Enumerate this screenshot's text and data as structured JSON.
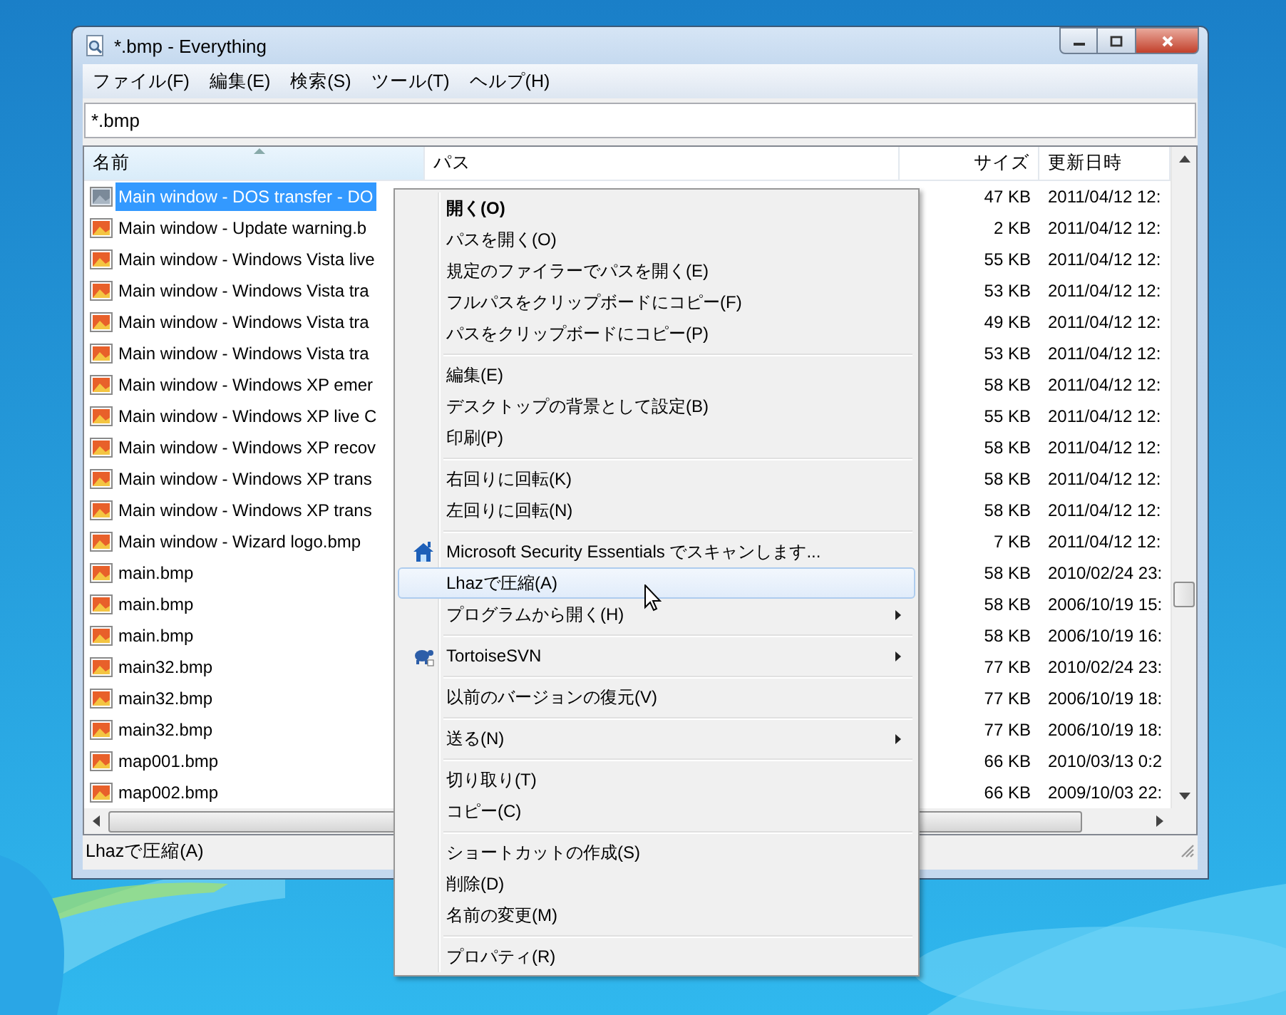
{
  "window": {
    "title": "*.bmp - Everything"
  },
  "menu_bar": [
    "ファイル(F)",
    "編集(E)",
    "検索(S)",
    "ツール(T)",
    "ヘルプ(H)"
  ],
  "search": {
    "value": "*.bmp"
  },
  "table": {
    "columns": [
      {
        "label": "名前",
        "sorted": true
      },
      {
        "label": "パス",
        "sorted": false
      },
      {
        "label": "サイズ",
        "sorted": false
      },
      {
        "label": "更新日時",
        "sorted": false
      }
    ],
    "rows": [
      {
        "name": "Main window - DOS transfer - DO",
        "size": "47 KB",
        "modified": "2011/04/12 12:",
        "selected": true
      },
      {
        "name": "Main window - Update warning.b",
        "size": "2 KB",
        "modified": "2011/04/12 12:",
        "selected": false
      },
      {
        "name": "Main window - Windows Vista live",
        "size": "55 KB",
        "modified": "2011/04/12 12:",
        "selected": false
      },
      {
        "name": "Main window - Windows Vista tra",
        "size": "53 KB",
        "modified": "2011/04/12 12:",
        "selected": false
      },
      {
        "name": "Main window - Windows Vista tra",
        "size": "49 KB",
        "modified": "2011/04/12 12:",
        "selected": false
      },
      {
        "name": "Main window - Windows Vista tra",
        "size": "53 KB",
        "modified": "2011/04/12 12:",
        "selected": false
      },
      {
        "name": "Main window - Windows XP emer",
        "size": "58 KB",
        "modified": "2011/04/12 12:",
        "selected": false
      },
      {
        "name": "Main window - Windows XP live C",
        "size": "55 KB",
        "modified": "2011/04/12 12:",
        "selected": false
      },
      {
        "name": "Main window - Windows XP recov",
        "size": "58 KB",
        "modified": "2011/04/12 12:",
        "selected": false
      },
      {
        "name": "Main window - Windows XP trans",
        "size": "58 KB",
        "modified": "2011/04/12 12:",
        "selected": false
      },
      {
        "name": "Main window - Windows XP trans",
        "size": "58 KB",
        "modified": "2011/04/12 12:",
        "selected": false
      },
      {
        "name": "Main window - Wizard logo.bmp",
        "size": "7 KB",
        "modified": "2011/04/12 12:",
        "selected": false
      },
      {
        "name": "main.bmp",
        "size": "58 KB",
        "modified": "2010/02/24 23:",
        "selected": false
      },
      {
        "name": "main.bmp",
        "size": "58 KB",
        "modified": "2006/10/19 15:",
        "selected": false
      },
      {
        "name": "main.bmp",
        "size": "58 KB",
        "modified": "2006/10/19 16:",
        "selected": false
      },
      {
        "name": "main32.bmp",
        "size": "77 KB",
        "modified": "2010/02/24 23:",
        "selected": false
      },
      {
        "name": "main32.bmp",
        "size": "77 KB",
        "modified": "2006/10/19 18:",
        "selected": false
      },
      {
        "name": "main32.bmp",
        "size": "77 KB",
        "modified": "2006/10/19 18:",
        "selected": false
      },
      {
        "name": "map001.bmp",
        "size": "66 KB",
        "modified": "2010/03/13 0:2",
        "selected": false
      },
      {
        "name": "map002.bmp",
        "size": "66 KB",
        "modified": "2009/10/03 22:",
        "selected": false
      }
    ]
  },
  "status_bar": "Lhazで圧縮(A)",
  "context_menu": [
    {
      "kind": "item",
      "label": "開く(O)",
      "default": true,
      "selected": false
    },
    {
      "kind": "item",
      "label": "パスを開く(O)",
      "selected": false
    },
    {
      "kind": "item",
      "label": "規定のファイラーでパスを開く(E)",
      "selected": false
    },
    {
      "kind": "item",
      "label": "フルパスをクリップボードにコピー(F)",
      "selected": false
    },
    {
      "kind": "item",
      "label": "パスをクリップボードにコピー(P)",
      "selected": false
    },
    {
      "kind": "separator"
    },
    {
      "kind": "item",
      "label": "編集(E)",
      "selected": false
    },
    {
      "kind": "item",
      "label": "デスクトップの背景として設定(B)",
      "selected": false
    },
    {
      "kind": "item",
      "label": "印刷(P)",
      "selected": false
    },
    {
      "kind": "separator"
    },
    {
      "kind": "item",
      "label": "右回りに回転(K)",
      "selected": false
    },
    {
      "kind": "item",
      "label": "左回りに回転(N)",
      "selected": false
    },
    {
      "kind": "separator"
    },
    {
      "kind": "icon_item",
      "label": "Microsoft Security Essentials でスキャンします...",
      "selected": false
    },
    {
      "kind": "item",
      "label": "Lhazで圧縮(A)",
      "selected": true
    },
    {
      "kind": "item",
      "label": "プログラムから開く(H)",
      "submenu": true,
      "selected": false
    },
    {
      "kind": "separator"
    },
    {
      "kind": "icon_item",
      "label": "TortoiseSVN",
      "submenu": true,
      "selected": false
    },
    {
      "kind": "separator"
    },
    {
      "kind": "item",
      "label": "以前のバージョンの復元(V)",
      "selected": false
    },
    {
      "kind": "separator"
    },
    {
      "kind": "item",
      "label": "送る(N)",
      "submenu": true,
      "selected": false
    },
    {
      "kind": "separator"
    },
    {
      "kind": "item",
      "label": "切り取り(T)",
      "selected": false
    },
    {
      "kind": "item",
      "label": "コピー(C)",
      "selected": false
    },
    {
      "kind": "separator"
    },
    {
      "kind": "item",
      "label": "ショートカットの作成(S)",
      "selected": false
    },
    {
      "kind": "item",
      "label": "削除(D)",
      "selected": false
    },
    {
      "kind": "item",
      "label": "名前の変更(M)",
      "selected": false
    },
    {
      "kind": "separator"
    },
    {
      "kind": "item",
      "label": "プロパティ(R)",
      "selected": false
    }
  ]
}
